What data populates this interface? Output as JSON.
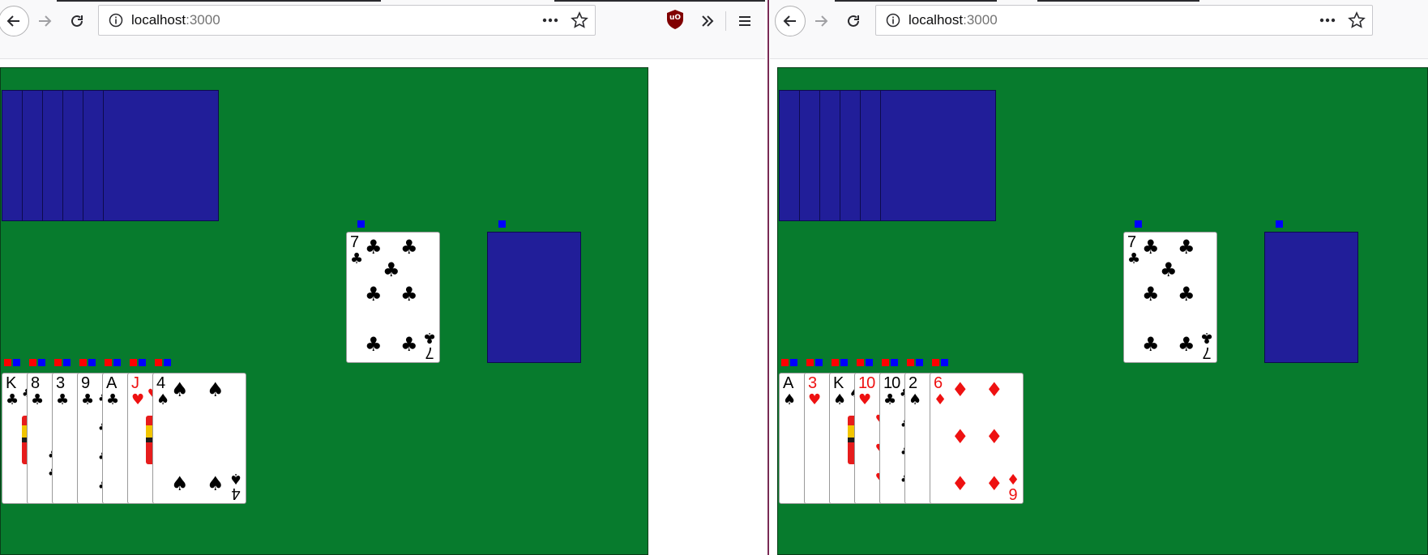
{
  "browser": {
    "url_host": "localhost",
    "url_port": ":3000",
    "extension_badge": "uO",
    "icons": [
      "back-arrow-icon",
      "forward-arrow-icon",
      "reload-icon",
      "info-icon",
      "page-actions-icon",
      "bookmark-star-icon",
      "ublock-icon",
      "overflow-chevrons-icon",
      "menu-icon"
    ]
  },
  "colors": {
    "table_green": "#077b2d",
    "card_back_blue": "#211e99",
    "marker_red": "#ff0000",
    "marker_blue": "#0000ff",
    "suit_red": "#ee1111"
  },
  "left_window": {
    "deck_count": 6,
    "pile": {
      "rank": "7",
      "suit": "♣",
      "color": "black"
    },
    "hand": [
      {
        "rank": "K",
        "suit": "♣",
        "color": "black"
      },
      {
        "rank": "8",
        "suit": "♣",
        "color": "black"
      },
      {
        "rank": "3",
        "suit": "♣",
        "color": "black"
      },
      {
        "rank": "9",
        "suit": "♣",
        "color": "black"
      },
      {
        "rank": "A",
        "suit": "♣",
        "color": "black"
      },
      {
        "rank": "J",
        "suit": "♥",
        "color": "red"
      },
      {
        "rank": "4",
        "suit": "♠",
        "color": "black"
      }
    ]
  },
  "right_window": {
    "deck_count": 6,
    "pile": {
      "rank": "7",
      "suit": "♣",
      "color": "black"
    },
    "hand": [
      {
        "rank": "A",
        "suit": "♠",
        "color": "black"
      },
      {
        "rank": "3",
        "suit": "♥",
        "color": "red"
      },
      {
        "rank": "K",
        "suit": "♠",
        "color": "black"
      },
      {
        "rank": "10",
        "suit": "♥",
        "color": "red"
      },
      {
        "rank": "10",
        "suit": "♣",
        "color": "black"
      },
      {
        "rank": "2",
        "suit": "♠",
        "color": "black"
      },
      {
        "rank": "6",
        "suit": "♦",
        "color": "red"
      }
    ]
  }
}
